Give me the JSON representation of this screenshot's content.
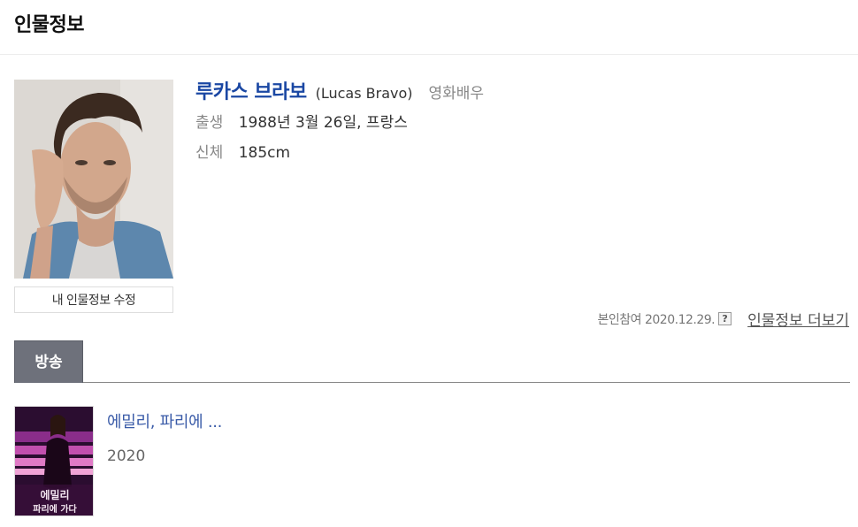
{
  "page": {
    "title": "인물정보"
  },
  "person": {
    "name_ko": "루카스 브라보",
    "name_en": "(Lucas Bravo)",
    "occupation": "영화배우",
    "birth_label": "출생",
    "birth_value": "1988년 3월 26일, 프랑스",
    "body_label": "신체",
    "body_value": "185cm"
  },
  "edit_button": {
    "label": "내 인물정보 수정"
  },
  "meta": {
    "verified_text": "본인참여 2020.12.29.",
    "help_icon_glyph": "?",
    "more_link": "인물정보 더보기"
  },
  "tabs": [
    {
      "label": "방송",
      "active": true
    }
  ],
  "works": [
    {
      "title": "에밀리, 파리에 ...",
      "year": "2020",
      "poster_text_line1": "에밀리",
      "poster_text_line2": "파리에 가다"
    }
  ],
  "colors": {
    "name_link": "#1a47a3",
    "work_link": "#3a5ba8",
    "tab_active_bg": "#6e717b"
  },
  "icons": {
    "help": "question-mark-box-icon"
  }
}
